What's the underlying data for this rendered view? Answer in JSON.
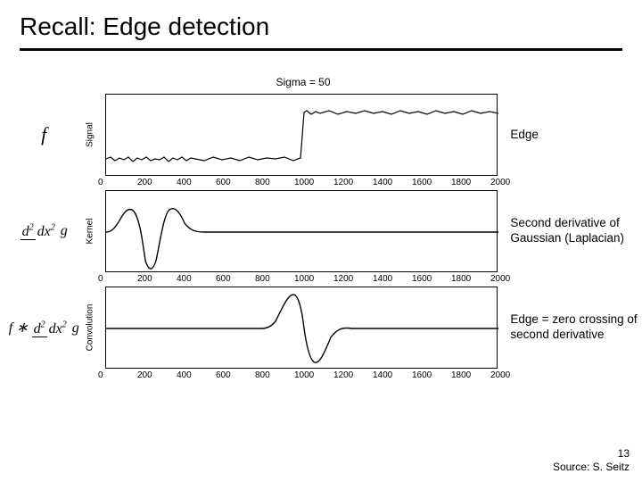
{
  "title": "Recall: Edge detection",
  "sigma_label": "Sigma = 50",
  "rows": {
    "r1": {
      "symbol": "f",
      "ylabel": "Signal",
      "caption": "Edge"
    },
    "r2": {
      "symbol": "d2dx2_g",
      "ylabel": "Kernel",
      "caption": "Second derivative of Gaussian (Laplacian)"
    },
    "r3": {
      "symbol": "f_conv_d2dx2_g",
      "ylabel": "Convolution",
      "caption": "Edge = zero crossing of second derivative"
    }
  },
  "xticks": [
    "0",
    "200",
    "400",
    "600",
    "800",
    "1000",
    "1200",
    "1400",
    "1600",
    "1800",
    "2000"
  ],
  "footer": {
    "page": "13",
    "source": "Source: S. Seitz"
  },
  "chart_data": [
    {
      "type": "line",
      "name": "signal",
      "title": "Sigma = 50",
      "xlabel": "",
      "ylabel": "Signal",
      "xlim": [
        0,
        2000
      ],
      "ylim": [
        -1.1,
        1.1
      ],
      "description": "Noisy step edge: value ≈ -1 for x < 1000, value ≈ +1 for x > 1000, with additive noise."
    },
    {
      "type": "line",
      "name": "laplacian_of_gaussian_kernel",
      "xlabel": "",
      "ylabel": "Kernel",
      "xlim": [
        0,
        2000
      ],
      "x": [
        0,
        50,
        100,
        150,
        200,
        250,
        300,
        350,
        400,
        450,
        500
      ],
      "values": [
        0,
        0.15,
        0.55,
        0.2,
        -1.0,
        0.2,
        0.55,
        0.15,
        0,
        0,
        0
      ],
      "description": "Second derivative of Gaussian (Laplacian) kernel, sigma=50, centered near x≈200; zero elsewhere."
    },
    {
      "type": "line",
      "name": "convolution_result",
      "xlabel": "",
      "ylabel": "Convolution",
      "xlim": [
        0,
        2000
      ],
      "x": [
        0,
        800,
        850,
        900,
        950,
        1000,
        1050,
        1100,
        1150,
        1200,
        1300,
        2000
      ],
      "values": [
        0,
        0,
        0.05,
        0.4,
        1.0,
        0.0,
        -0.9,
        -0.35,
        -0.1,
        0.05,
        0,
        0
      ],
      "description": "f * (d²/dx² g): zero baseline with positive peak just before x=1000 and negative trough just after; zero crossing at x≈1000 marks the edge."
    }
  ]
}
